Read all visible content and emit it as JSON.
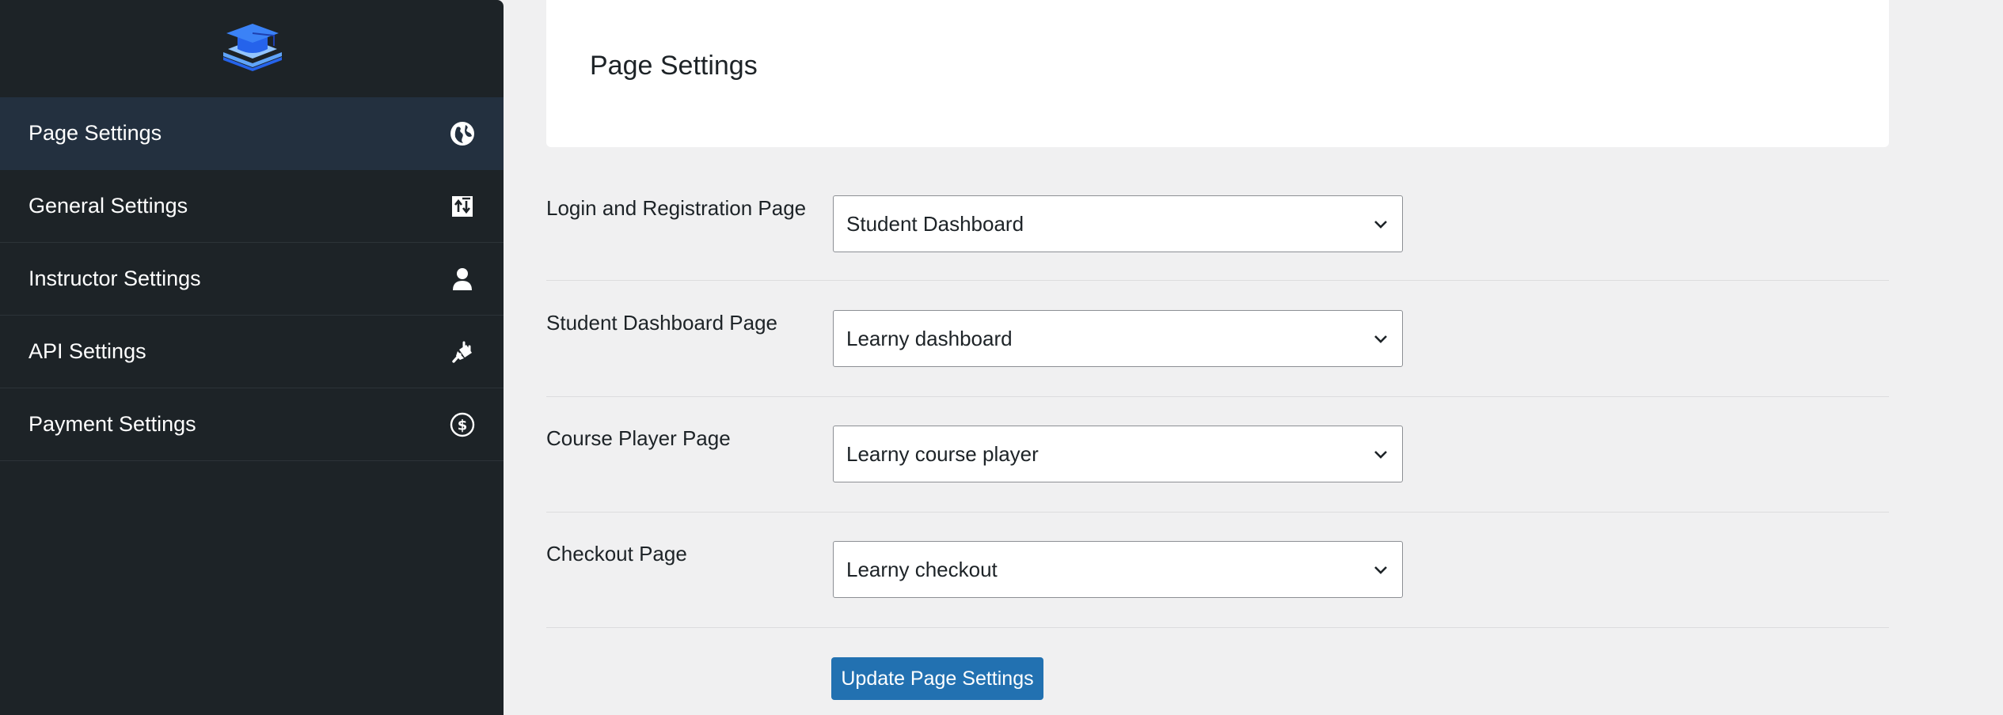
{
  "sidebar": {
    "logo_icon": "graduation-cap-book-icon",
    "items": [
      {
        "label": "Page Settings",
        "icon": "globe-icon",
        "active": true
      },
      {
        "label": "General Settings",
        "icon": "sort-arrows-icon",
        "active": false
      },
      {
        "label": "Instructor Settings",
        "icon": "person-icon",
        "active": false
      },
      {
        "label": "API Settings",
        "icon": "plug-icon",
        "active": false
      },
      {
        "label": "Payment Settings",
        "icon": "dollar-circle-icon",
        "active": false
      }
    ]
  },
  "header": {
    "title": "Page Settings"
  },
  "settings": [
    {
      "label": "Login and Registration Page",
      "value": "Student Dashboard"
    },
    {
      "label": "Student Dashboard Page",
      "value": "Learny dashboard"
    },
    {
      "label": "Course Player Page",
      "value": "Learny course player"
    },
    {
      "label": "Checkout Page",
      "value": "Learny checkout"
    }
  ],
  "submit_label": "Update Page Settings",
  "colors": {
    "sidebar_bg": "#1d2327",
    "active_item_bg": "#23303f",
    "button_bg": "#2271b1",
    "logo_blue": "#3b82f6"
  }
}
